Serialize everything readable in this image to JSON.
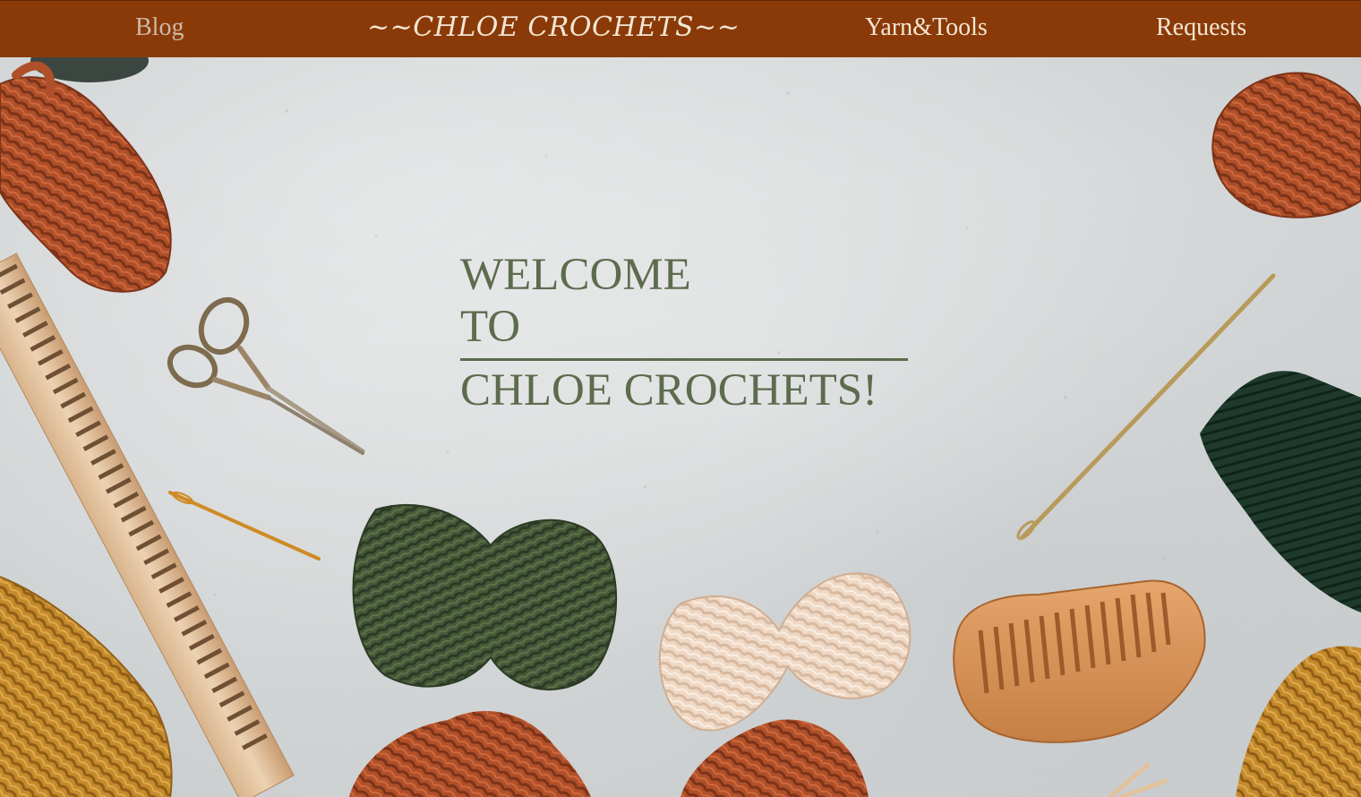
{
  "nav": {
    "blog_label": "Blog",
    "brand_label": "~~CHLOE CROCHETS~~",
    "yarn_tools_label": "Yarn&Tools",
    "requests_label": "Requests"
  },
  "hero": {
    "line1": "WELCOME",
    "line2": "TO",
    "line3": "CHLOE CROCHETS!"
  },
  "colors": {
    "navbar_bg": "#8a3a08",
    "nav_text": "#f3e6d4",
    "nav_active_text": "#cdb9a6",
    "hero_text": "#5d6b4e",
    "background": "#d6d8d8"
  }
}
